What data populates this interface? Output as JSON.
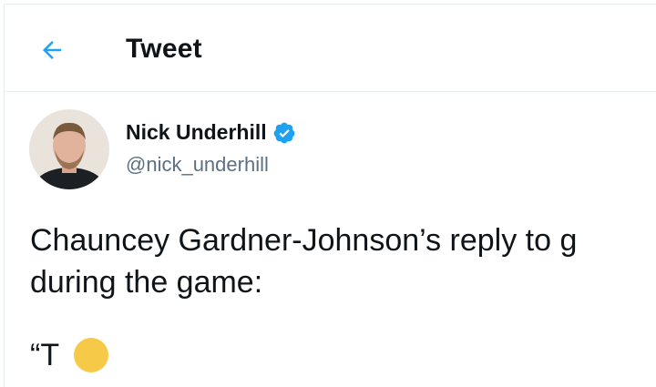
{
  "header": {
    "back_icon": "arrow-left-icon",
    "title": "Tweet"
  },
  "author": {
    "name": "Nick Underhill",
    "handle": "@nick_underhill",
    "verified_icon": "verified-badge-icon"
  },
  "tweet": {
    "line1": "Chauncey Gardner-Johnson’s reply to g",
    "line2": "during the game:",
    "line3": "“T",
    "emoji_icon": "emoji-face-icon"
  },
  "colors": {
    "accent": "#1da1f2",
    "text": "#0f1419",
    "secondary_text": "#5b7083",
    "divider": "#e6ecf0"
  }
}
